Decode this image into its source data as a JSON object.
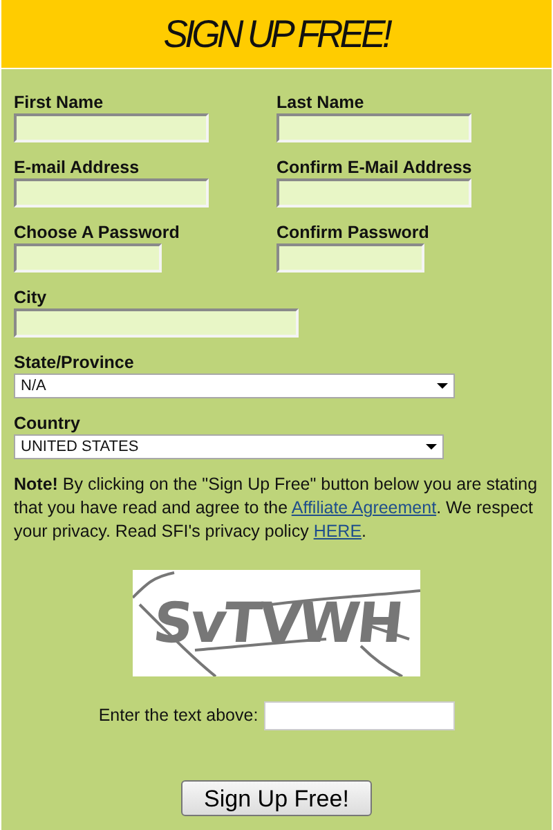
{
  "header": {
    "title": "SIGN UP FREE!"
  },
  "field_rows": [
    {
      "fields": [
        {
          "label": "First Name"
        },
        {
          "label": "Last Name"
        }
      ]
    },
    {
      "fields": [
        {
          "label": "E-mail Address"
        },
        {
          "label": "Confirm E-Mail Address"
        }
      ]
    },
    {
      "fields": [
        {
          "label": "Choose A Password"
        },
        {
          "label": "Confirm Password"
        }
      ]
    },
    {
      "fields": [
        {
          "label": "City"
        }
      ]
    }
  ],
  "selects": [
    {
      "label": "State/Province",
      "value": "N/A"
    },
    {
      "label": "Country",
      "value": "UNITED STATES"
    }
  ],
  "note": {
    "text": "**Note!** By clicking on the \"Sign Up Free\" button below you are stating that you have read and agree to the ",
    "link": "Affiliate Agreement",
    "text_after": ". We respect your privacy. Read SFI's privacy policy ",
    "link_2": "HERE",
    "end": "."
  },
  "captcha": {
    "text": "SvTVWH",
    "prompt": "Enter the text above:"
  },
  "submit": {
    "label": "Sign Up Free!"
  }
}
